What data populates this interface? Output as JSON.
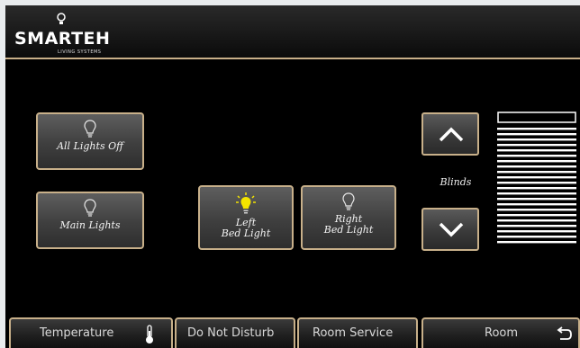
{
  "header": {
    "logo_text": "SMARTEH",
    "logo_subtext": "LIVING SYSTEMS"
  },
  "lights": {
    "all_off": {
      "label": "All Lights Off",
      "state": "off"
    },
    "main": {
      "label": "Main Lights",
      "state": "off"
    },
    "left_bed": {
      "label_line1": "Left",
      "label_line2": "Bed Light",
      "state": "on"
    },
    "right_bed": {
      "label_line1": "Right",
      "label_line2": "Bed Light",
      "state": "off"
    }
  },
  "blinds": {
    "label": "Blinds",
    "up_icon": "chevron-up-icon",
    "down_icon": "chevron-down-icon",
    "level": 0.87
  },
  "footer": {
    "tabs": [
      {
        "label": "Temperature",
        "icon": "thermometer-icon"
      },
      {
        "label": "Do Not Disturb"
      },
      {
        "label": "Room Service"
      },
      {
        "label": "Room",
        "icon": "back-arrow-icon"
      }
    ]
  },
  "colors": {
    "accent_border": "#c8b08a",
    "bulb_on": "#f4e400",
    "bulb_off": "#e8e8e8",
    "background": "#000000"
  }
}
